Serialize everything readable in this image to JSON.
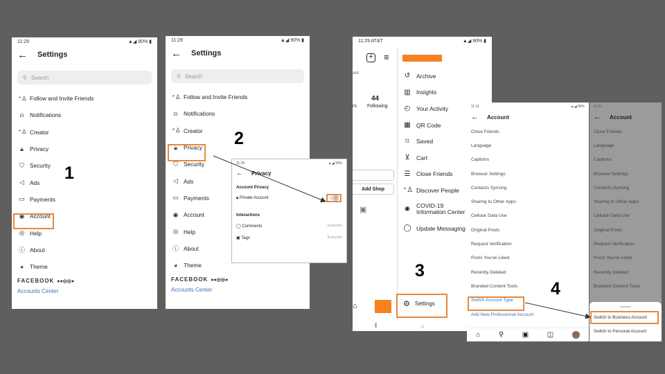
{
  "steps": [
    "1",
    "2",
    "3",
    "4"
  ],
  "status": {
    "time1": "11:29",
    "time3": "11:29 AT&T",
    "time4": "11:31",
    "right": "90%"
  },
  "screen1": {
    "title": "Settings",
    "search_placeholder": "Search",
    "items": [
      {
        "label": "Follow and Invite Friends",
        "icon": "add-person-icon"
      },
      {
        "label": "Notifications",
        "icon": "bell-icon"
      },
      {
        "label": "Creator",
        "icon": "add-person-icon"
      },
      {
        "label": "Privacy",
        "icon": "lock-icon"
      },
      {
        "label": "Security",
        "icon": "shield-icon"
      },
      {
        "label": "Ads",
        "icon": "megaphone-icon"
      },
      {
        "label": "Payments",
        "icon": "card-icon"
      },
      {
        "label": "Account",
        "icon": "person-circle-icon"
      },
      {
        "label": "Help",
        "icon": "lifebuoy-icon"
      },
      {
        "label": "About",
        "icon": "info-icon"
      },
      {
        "label": "Theme",
        "icon": "palette-icon"
      }
    ],
    "facebook": "FACEBOOK",
    "accounts_center": "Accounts Center"
  },
  "screen2": {
    "title": "Settings",
    "search_placeholder": "Search",
    "items": [
      {
        "label": "Follow and Invite Friends"
      },
      {
        "label": "Notifications"
      },
      {
        "label": "Creator"
      },
      {
        "label": "Privacy"
      },
      {
        "label": "Security"
      },
      {
        "label": "Ads"
      },
      {
        "label": "Payments"
      },
      {
        "label": "Account"
      },
      {
        "label": "Help"
      },
      {
        "label": "About"
      },
      {
        "label": "Theme"
      }
    ],
    "facebook": "FACEBOOK",
    "accounts_center": "Accounts Center"
  },
  "privacy_popup": {
    "time": "11:29",
    "battery": "90%",
    "title": "Privacy",
    "section1": "Account Privacy",
    "private_account": "Private Account",
    "section2": "Interactions",
    "comments": "Comments",
    "comments_value": "Everyone",
    "tags": "Tags",
    "tags_value": "Everyone"
  },
  "screen3": {
    "following_count": "44",
    "following_label": "Following",
    "frag_left1": "ard",
    "frag_left2": "rs",
    "add_shop": "Add Shop",
    "menu": [
      {
        "label": "Archive",
        "icon": "archive-icon"
      },
      {
        "label": "Insights",
        "icon": "bar-chart-icon"
      },
      {
        "label": "Your Activity",
        "icon": "clock-icon"
      },
      {
        "label": "QR Code",
        "icon": "qr-icon"
      },
      {
        "label": "Saved",
        "icon": "bookmark-icon"
      },
      {
        "label": "Cart",
        "icon": "cart-icon"
      },
      {
        "label": "Close Friends",
        "icon": "list-icon"
      },
      {
        "label": "Discover People",
        "icon": "add-person-icon"
      },
      {
        "label": "COVID-19 Information Center",
        "icon": "covid-icon"
      },
      {
        "label": "Update Messaging",
        "icon": "messenger-icon"
      }
    ],
    "settings_label": "Settings"
  },
  "screen4": {
    "title": "Account",
    "items": [
      "Close Friends",
      "Language",
      "Captions",
      "Browser Settings",
      "Contacts Syncing",
      "Sharing to Other Apps",
      "Cellular Data Use",
      "Original Posts",
      "Request Verification",
      "Posts You've Liked",
      "Recently Deleted",
      "Branded Content Tools",
      "Switch Account Type",
      "Add New Professional Account"
    ]
  },
  "screen5": {
    "title": "Account",
    "items": [
      "Close Friends",
      "Language",
      "Captions",
      "Browser Settings",
      "Contacts Syncing",
      "Sharing to Other Apps",
      "Cellular Data Use",
      "Original Posts",
      "Request Verification",
      "Posts You've Liked",
      "Recently Deleted",
      "Branded Content Tools"
    ],
    "switch_business": "Switch to Business Account",
    "switch_personal": "Switch to Personal Account"
  },
  "colors": {
    "highlight": "#e8883c",
    "brand": "#f5821f",
    "link": "#3b6fb6"
  }
}
